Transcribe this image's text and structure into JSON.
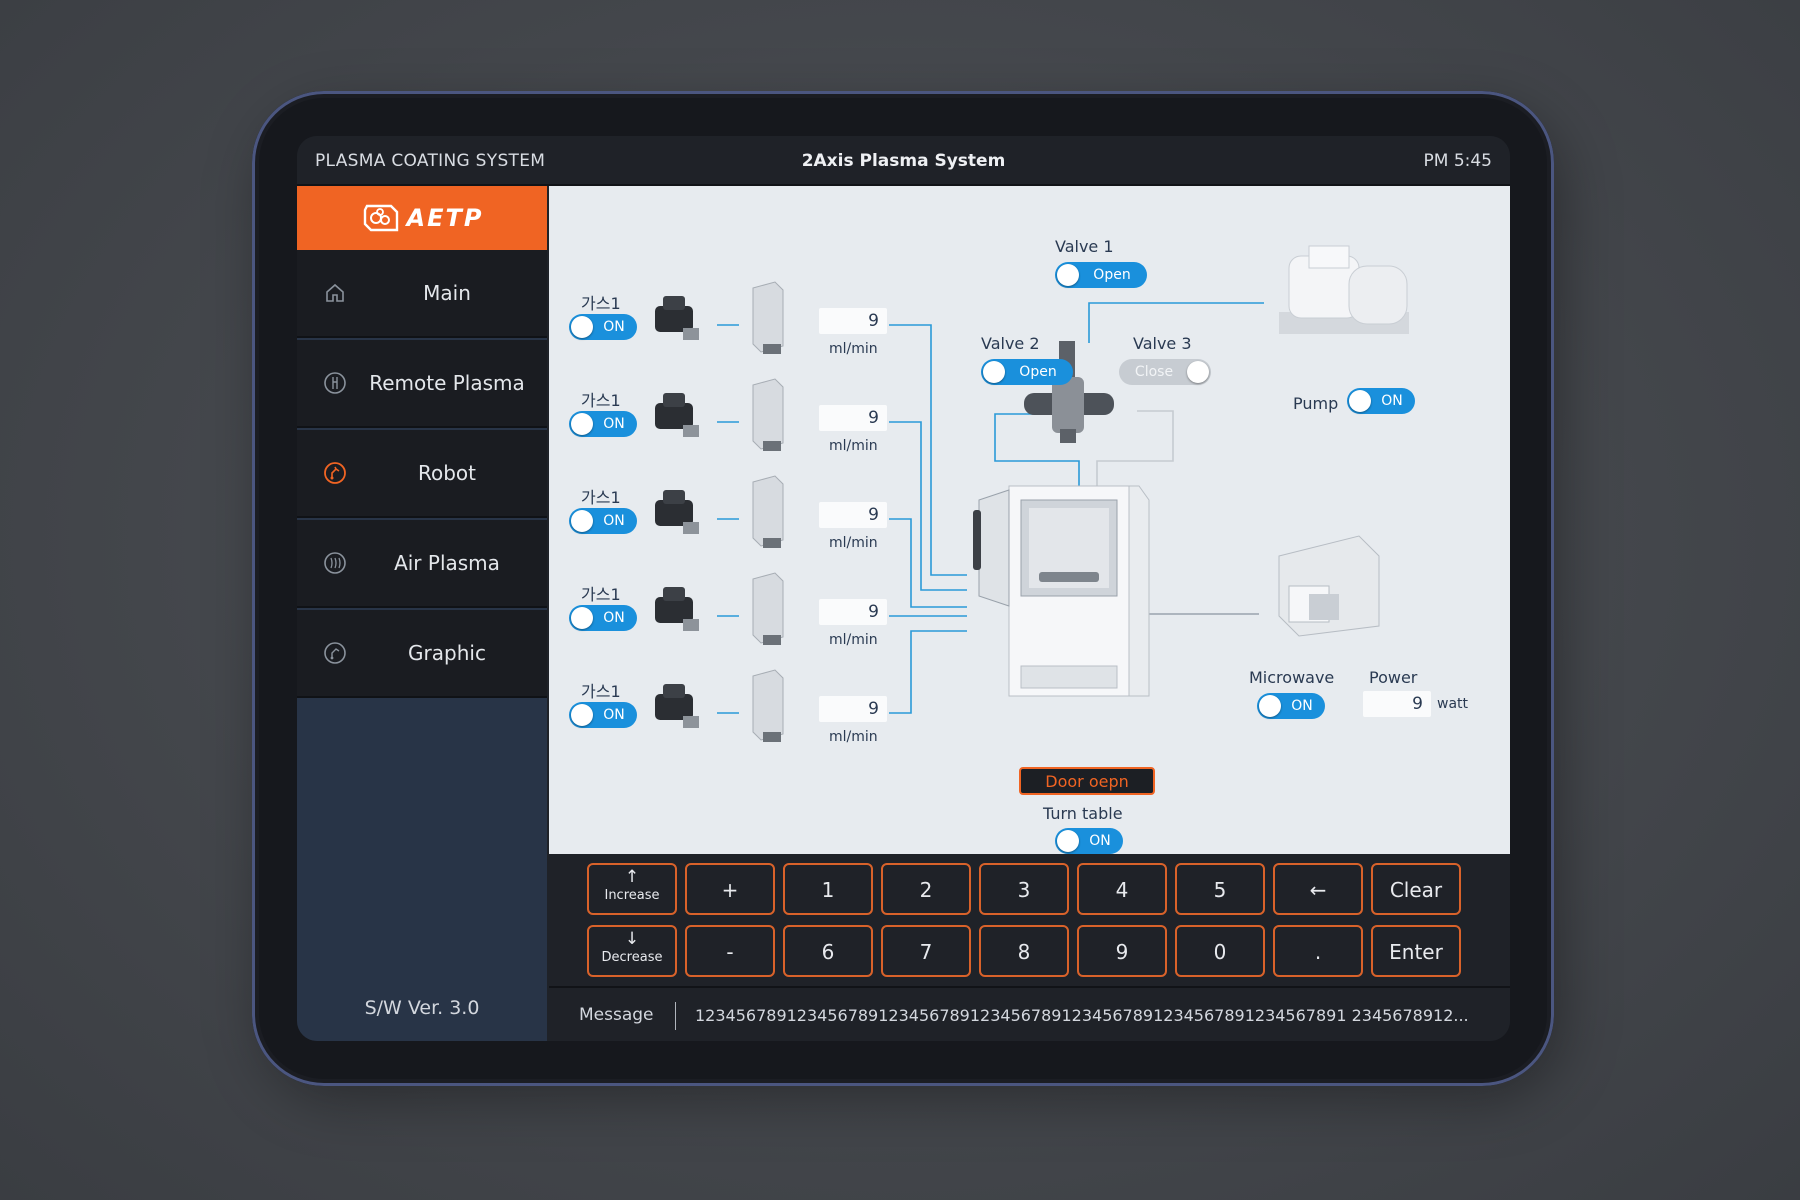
{
  "header": {
    "system_name": "PLASMA COATING SYSTEM",
    "title": "2Axis Plasma System",
    "time": "PM 5:45"
  },
  "sidebar": {
    "logo_text": "AETP",
    "items": [
      {
        "label": "Main",
        "icon": "home-icon"
      },
      {
        "label": "Remote Plasma",
        "icon": "remote-plasma-icon"
      },
      {
        "label": "Robot",
        "icon": "robot-icon",
        "active": true
      },
      {
        "label": "Air Plasma",
        "icon": "air-plasma-icon"
      },
      {
        "label": "Graphic",
        "icon": "graphic-icon"
      }
    ],
    "version": "S/W Ver. 3.0"
  },
  "gas_lines": [
    {
      "label": "가스1",
      "toggle": "ON",
      "value": "9",
      "unit": "ml/min"
    },
    {
      "label": "가스1",
      "toggle": "ON",
      "value": "9",
      "unit": "ml/min"
    },
    {
      "label": "가스1",
      "toggle": "ON",
      "value": "9",
      "unit": "ml/min"
    },
    {
      "label": "가스1",
      "toggle": "ON",
      "value": "9",
      "unit": "ml/min"
    },
    {
      "label": "가스1",
      "toggle": "ON",
      "value": "9",
      "unit": "ml/min"
    }
  ],
  "valves": {
    "valve1": {
      "label": "Valve 1",
      "state": "Open"
    },
    "valve2": {
      "label": "Valve 2",
      "state": "Open"
    },
    "valve3": {
      "label": "Valve 3",
      "state": "Close"
    }
  },
  "pump": {
    "label": "Pump",
    "state": "ON"
  },
  "microwave": {
    "label": "Microwave",
    "state": "ON"
  },
  "power": {
    "label": "Power",
    "value": "9",
    "unit": "watt"
  },
  "chamber": {
    "door_button": "Door oepn",
    "turntable_label": "Turn table",
    "turntable_state": "ON"
  },
  "keypad": {
    "increase": "Increase",
    "decrease": "Decrease",
    "up_arrow": "↑",
    "down_arrow": "↓",
    "row1": [
      "+",
      "1",
      "2",
      "3",
      "4",
      "5",
      "←",
      "Clear"
    ],
    "row2": [
      "-",
      "6",
      "7",
      "8",
      "9",
      "0",
      ".",
      "Enter"
    ]
  },
  "message": {
    "label": "Message",
    "text": "1234567891234567891234567891234567891234567891234567891234567891 2345678912..."
  },
  "colors": {
    "accent": "#f06423",
    "toggle_on": "#1a90dc",
    "pipe": "#2a9ad8",
    "sidebar_bg": "#283447"
  }
}
